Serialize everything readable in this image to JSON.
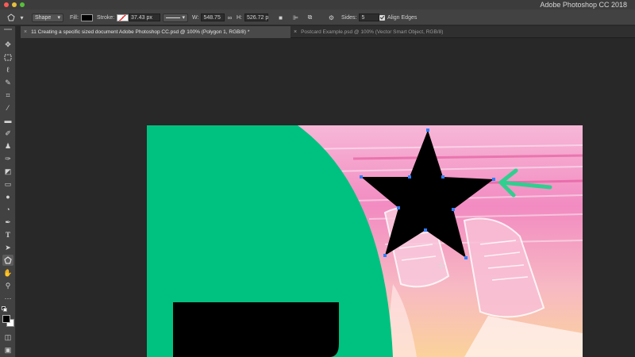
{
  "window": {
    "title": "Adobe Photoshop CC 2018"
  },
  "options_bar": {
    "tool_mode": "Shape",
    "fill_label": "Fill:",
    "stroke_label": "Stroke:",
    "stroke_width": "37.43 px",
    "w_label": "W:",
    "w_value": "548.75",
    "h_label": "H:",
    "h_value": "526.72 p",
    "sides_label": "Sides:",
    "sides_value": "5",
    "align_edges_label": "Align Edges",
    "align_edges_checked": true
  },
  "tabs": [
    {
      "label": "11 Creating a specific sized document Adobe Photoshop CC.psd @ 100% (Polygon 1, RGB/8) *",
      "active": true
    },
    {
      "label": "Postcard Example.psd @ 100% (Vector Smart Object, RGB/8)",
      "active": false
    }
  ],
  "colors": {
    "green_shape": "#00c280",
    "star_fill": "#000000",
    "anchor_points": "#2f7fff",
    "arrow_annotation": "#2fcf8f"
  },
  "toolbar": {
    "tools": [
      "move-icon",
      "marquee-icon",
      "lasso-icon",
      "quick-select-icon",
      "crop-icon",
      "eyedropper-icon",
      "healing-icon",
      "brush-icon",
      "stamp-icon",
      "history-brush-icon",
      "eraser-icon",
      "gradient-icon",
      "blur-icon",
      "dodge-icon",
      "pen-icon",
      "type-icon",
      "path-select-icon",
      "polygon-icon",
      "hand-icon",
      "zoom-icon",
      "more-icon"
    ]
  }
}
